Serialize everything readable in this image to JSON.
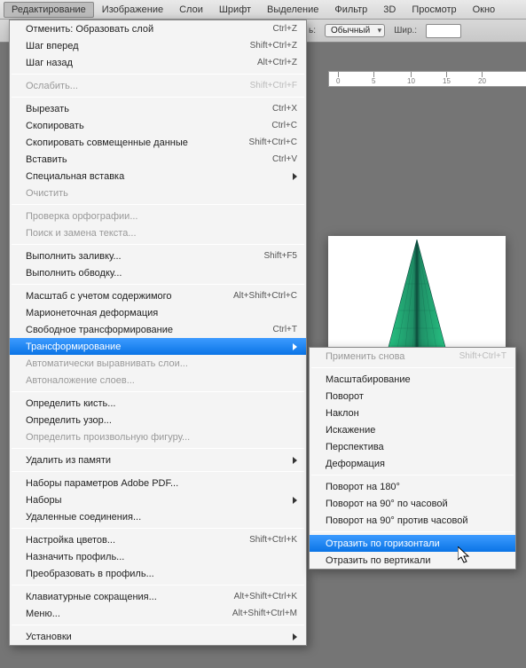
{
  "menubar": {
    "items": [
      "Редактирование",
      "Изображение",
      "Слои",
      "Шрифт",
      "Выделение",
      "Фильтр",
      "3D",
      "Просмотр",
      "Окно"
    ]
  },
  "toolbar": {
    "style_label": "ь:",
    "style_value": "Обычный",
    "width_label": "Шир.:",
    "width_value": ""
  },
  "ruler": {
    "ticks": [
      "0",
      "5",
      "10",
      "15",
      "20"
    ]
  },
  "main_menu": [
    {
      "t": "item",
      "label": "Отменить: Образовать слой",
      "sc": "Ctrl+Z"
    },
    {
      "t": "item",
      "label": "Шаг вперед",
      "sc": "Shift+Ctrl+Z"
    },
    {
      "t": "item",
      "label": "Шаг назад",
      "sc": "Alt+Ctrl+Z"
    },
    {
      "t": "sep"
    },
    {
      "t": "item",
      "label": "Ослабить...",
      "sc": "Shift+Ctrl+F",
      "disabled": true
    },
    {
      "t": "sep"
    },
    {
      "t": "item",
      "label": "Вырезать",
      "sc": "Ctrl+X"
    },
    {
      "t": "item",
      "label": "Скопировать",
      "sc": "Ctrl+C"
    },
    {
      "t": "item",
      "label": "Скопировать совмещенные данные",
      "sc": "Shift+Ctrl+C"
    },
    {
      "t": "item",
      "label": "Вставить",
      "sc": "Ctrl+V"
    },
    {
      "t": "item",
      "label": "Специальная вставка",
      "sub": true
    },
    {
      "t": "item",
      "label": "Очистить",
      "disabled": true
    },
    {
      "t": "sep"
    },
    {
      "t": "item",
      "label": "Проверка орфографии...",
      "disabled": true
    },
    {
      "t": "item",
      "label": "Поиск и замена текста...",
      "disabled": true
    },
    {
      "t": "sep"
    },
    {
      "t": "item",
      "label": "Выполнить заливку...",
      "sc": "Shift+F5"
    },
    {
      "t": "item",
      "label": "Выполнить обводку..."
    },
    {
      "t": "sep"
    },
    {
      "t": "item",
      "label": "Масштаб с учетом содержимого",
      "sc": "Alt+Shift+Ctrl+C"
    },
    {
      "t": "item",
      "label": "Марионеточная деформация"
    },
    {
      "t": "item",
      "label": "Свободное трансформирование",
      "sc": "Ctrl+T"
    },
    {
      "t": "item",
      "label": "Трансформирование",
      "sub": true,
      "highlight": true
    },
    {
      "t": "item",
      "label": "Автоматически выравнивать слои...",
      "disabled": true
    },
    {
      "t": "item",
      "label": "Автоналожение слоев...",
      "disabled": true
    },
    {
      "t": "sep"
    },
    {
      "t": "item",
      "label": "Определить кисть..."
    },
    {
      "t": "item",
      "label": "Определить узор..."
    },
    {
      "t": "item",
      "label": "Определить произвольную фигуру...",
      "disabled": true
    },
    {
      "t": "sep"
    },
    {
      "t": "item",
      "label": "Удалить из памяти",
      "sub": true
    },
    {
      "t": "sep"
    },
    {
      "t": "item",
      "label": "Наборы параметров Adobe PDF..."
    },
    {
      "t": "item",
      "label": "Наборы",
      "sub": true
    },
    {
      "t": "item",
      "label": "Удаленные соединения..."
    },
    {
      "t": "sep"
    },
    {
      "t": "item",
      "label": "Настройка цветов...",
      "sc": "Shift+Ctrl+K"
    },
    {
      "t": "item",
      "label": "Назначить профиль..."
    },
    {
      "t": "item",
      "label": "Преобразовать в профиль..."
    },
    {
      "t": "sep"
    },
    {
      "t": "item",
      "label": "Клавиатурные сокращения...",
      "sc": "Alt+Shift+Ctrl+K"
    },
    {
      "t": "item",
      "label": "Меню...",
      "sc": "Alt+Shift+Ctrl+M"
    },
    {
      "t": "sep"
    },
    {
      "t": "item",
      "label": "Установки",
      "sub": true
    }
  ],
  "sub_menu": [
    {
      "t": "item",
      "label": "Применить снова",
      "sc": "Shift+Ctrl+T",
      "disabled": true
    },
    {
      "t": "sep"
    },
    {
      "t": "item",
      "label": "Масштабирование"
    },
    {
      "t": "item",
      "label": "Поворот"
    },
    {
      "t": "item",
      "label": "Наклон"
    },
    {
      "t": "item",
      "label": "Искажение"
    },
    {
      "t": "item",
      "label": "Перспектива"
    },
    {
      "t": "item",
      "label": "Деформация"
    },
    {
      "t": "sep"
    },
    {
      "t": "item",
      "label": "Поворот на 180°"
    },
    {
      "t": "item",
      "label": "Поворот на 90° по часовой"
    },
    {
      "t": "item",
      "label": "Поворот на 90° против часовой"
    },
    {
      "t": "sep"
    },
    {
      "t": "item",
      "label": "Отразить по горизонтали",
      "highlight": true
    },
    {
      "t": "item",
      "label": "Отразить по вертикали"
    }
  ]
}
